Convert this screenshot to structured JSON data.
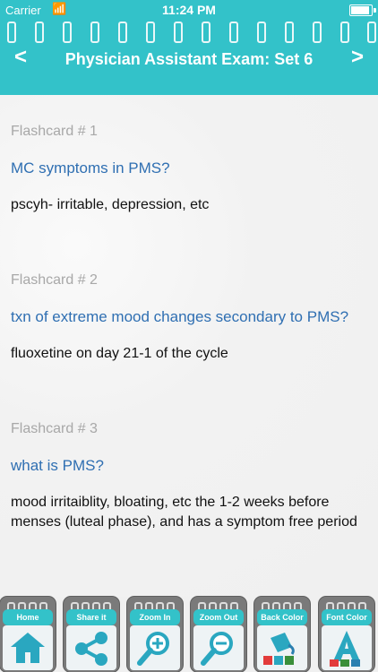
{
  "status": {
    "carrier": "Carrier",
    "time": "11:24 PM"
  },
  "header": {
    "title": "Physician Assistant Exam: Set 6",
    "left": "<",
    "right": ">"
  },
  "cards": [
    {
      "label": "Flashcard # 1",
      "question": "MC symptoms in PMS?",
      "answer": "pscyh- irritable, depression, etc"
    },
    {
      "label": "Flashcard # 2",
      "question": "txn of extreme mood changes secondary to PMS?",
      "answer": "fluoxetine on day 21-1 of the cycle"
    },
    {
      "label": "Flashcard # 3",
      "question": "what is PMS?",
      "answer": "mood irritaiblity, bloating, etc the 1-2 weeks before menses (luteal phase), and has a symptom free period"
    }
  ],
  "toolbar": {
    "home": "Home",
    "share": "Share it",
    "zoom_in": "Zoom In",
    "zoom_out": "Zoom Out",
    "back_color": "Back Color",
    "font_color": "Font Color"
  },
  "icons": {
    "home": "home-icon",
    "share": "share-icon",
    "zoom_in": "zoom-in-icon",
    "zoom_out": "zoom-out-icon",
    "back_color": "paint-bucket-icon",
    "font_color": "font-a-icon"
  },
  "colors": {
    "accent": "#33c2c9",
    "question": "#2f6fb2",
    "label": "#a8a8a8"
  }
}
